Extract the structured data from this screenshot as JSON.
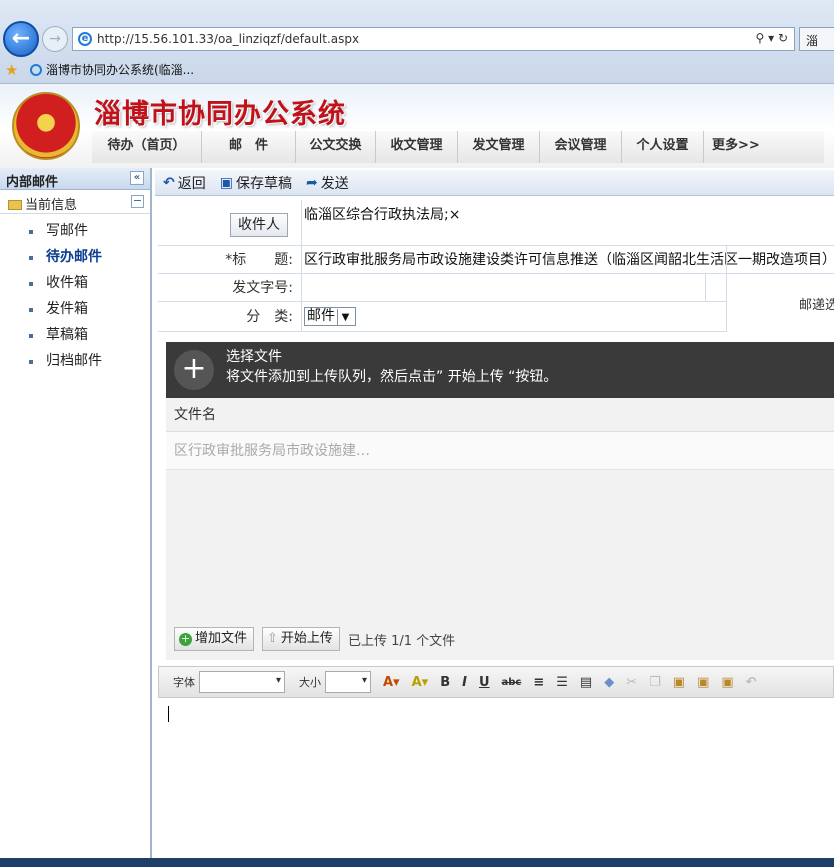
{
  "browser": {
    "url": "http://15.56.101.33/oa_linziqzf/default.aspx",
    "address_tools": "⚲ ▾ ↻",
    "tab2_label": "淄",
    "fav_tab_label": "淄博市协同办公系统(临淄..."
  },
  "app": {
    "title": "淄博市协同办公系统",
    "nav": [
      "待办（首页）",
      "邮　件",
      "公文交换",
      "收文管理",
      "发文管理",
      "会议管理",
      "个人设置",
      "更多>>"
    ]
  },
  "sidebar": {
    "header": "内部邮件",
    "collapse": "«",
    "section": "当前信息",
    "section_toggle": "−",
    "items": [
      "写邮件",
      "待办邮件",
      "收件箱",
      "发件箱",
      "草稿箱",
      "归档邮件"
    ],
    "active_index": 1
  },
  "toolbar": {
    "back": "返回",
    "save_draft": "保存草稿",
    "send": "发送"
  },
  "form": {
    "recipient_button": "收件人",
    "recipient_value": "临淄区综合行政执法局;×",
    "subject_label": "*标　　题:",
    "subject_value": "区行政审批服务局市政设施建设类许可信息推送（临淄区闻韶北生活区一期改造项目）",
    "docno_label": "发文字号:",
    "docno_value": "",
    "category_label": "分　类:",
    "category_value": "邮件",
    "mail_box_text": "邮递选"
  },
  "upload": {
    "title": "选择文件",
    "hint": "将文件添加到上传队列，然后点击” 开始上传 “按钮。",
    "column": "文件名",
    "file_name": "区行政审批服务局市政设施建…",
    "add_button": "增加文件",
    "start_button": "开始上传",
    "status": "已上传 1/1 个文件"
  },
  "editor": {
    "font_label": "字体",
    "size_label": "大小"
  }
}
